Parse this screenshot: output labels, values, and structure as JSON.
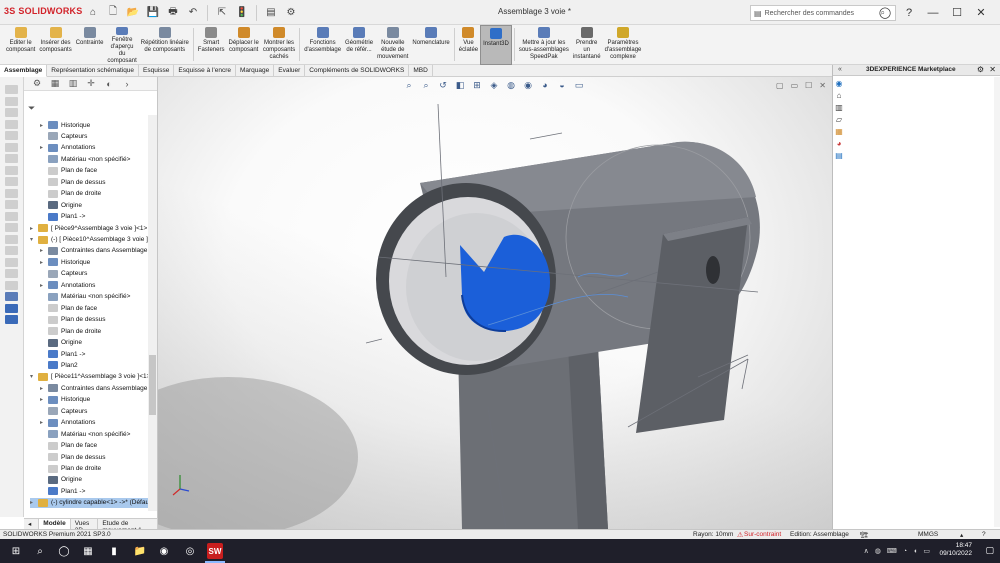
{
  "app": {
    "logo_text": "SOLIDWORKS",
    "logo_prefix": "3S",
    "document_title": "Assemblage 3 voie *"
  },
  "quick_access": [
    {
      "icon": "home-icon",
      "glyph": "⌂"
    },
    {
      "icon": "new-file-icon",
      "glyph": "🗋"
    },
    {
      "icon": "open-file-icon",
      "glyph": "📂"
    },
    {
      "icon": "save-icon",
      "glyph": "💾"
    },
    {
      "icon": "print-icon",
      "glyph": "🖶"
    },
    {
      "icon": "undo-icon",
      "glyph": "↶"
    },
    {
      "icon": "select-icon",
      "glyph": "⇱"
    },
    {
      "icon": "rebuild-icon",
      "glyph": "🚦"
    },
    {
      "icon": "file-properties-icon",
      "glyph": "▤"
    },
    {
      "icon": "options-icon",
      "glyph": "⚙"
    }
  ],
  "search": {
    "placeholder": "Rechercher des commandes",
    "value": ""
  },
  "ribbon": [
    {
      "id": "edit-component",
      "label": "Editer le\ncomposant",
      "color": "#e3b34a"
    },
    {
      "id": "insert-components",
      "label": "Insérer des\ncomposants",
      "color": "#e3b34a"
    },
    {
      "id": "constraint",
      "label": "Contrainte",
      "color": "#7a8aa0"
    },
    {
      "id": "preview-window",
      "label": "Fenêtre\nd'aperçu\ndu\ncomposant",
      "color": "#5a7cb8"
    },
    {
      "id": "linear-pattern",
      "label": "Répétition linéaire\nde composants",
      "color": "#7a8aa0"
    },
    {
      "id": "smart-fasteners",
      "label": "Smart\nFasteners",
      "color": "#8a8a8a"
    },
    {
      "id": "move-component",
      "label": "Déplacer le\ncomposant",
      "color": "#d08a2a"
    },
    {
      "id": "show-hidden",
      "label": "Montrer les\ncomposants\ncachés",
      "color": "#d08a2a"
    },
    {
      "id": "assembly-features",
      "label": "Fonctions\nd'assemblage",
      "color": "#5a7cb8"
    },
    {
      "id": "reference-geometry",
      "label": "Géométrie\nde référ...",
      "color": "#5a7cb8"
    },
    {
      "id": "new-motion-study",
      "label": "Nouvelle\nétude de\nmouvement",
      "color": "#7a8aa0"
    },
    {
      "id": "bom",
      "label": "Nomenclature",
      "color": "#5a7cb8"
    },
    {
      "id": "exploded-view",
      "label": "Vue\néclatée",
      "color": "#d08a2a"
    },
    {
      "id": "instant3d",
      "label": "Instant3D",
      "color": "#2f6ec8",
      "active": true
    },
    {
      "id": "update-speedpak",
      "label": "Mettre à jour les\nsous-assemblages\nSpeedPak",
      "color": "#5a7cb8"
    },
    {
      "id": "take-snapshot",
      "label": "Prendre\nun\ninstantané",
      "color": "#6a6a6a"
    },
    {
      "id": "large-assembly",
      "label": "Paramètres\nd'assemblage\ncomplexe",
      "color": "#d0a82a"
    }
  ],
  "command_tabs": [
    "Assemblage",
    "Représentation schématique",
    "Esquisse",
    "Esquisse à l'encre",
    "Marquage",
    "Evaluer",
    "Compléments de SOLIDWORKS",
    "MBD"
  ],
  "active_command_tab": "Assemblage",
  "tree": [
    {
      "label": "Historique",
      "level": 2,
      "twisty": "▸",
      "color": "#6c8ebf"
    },
    {
      "label": "Capteurs",
      "level": 2,
      "twisty": "",
      "color": "#9aa7b8"
    },
    {
      "label": "Annotations",
      "level": 2,
      "twisty": "▸",
      "color": "#6c8ebf"
    },
    {
      "label": "Matériau <non spécifié>",
      "level": 2,
      "twisty": "",
      "color": "#8aa1bf"
    },
    {
      "label": "Plan de face",
      "level": 2,
      "twisty": "",
      "color": "#cccccc"
    },
    {
      "label": "Plan de dessus",
      "level": 2,
      "twisty": "",
      "color": "#cccccc"
    },
    {
      "label": "Plan de droite",
      "level": 2,
      "twisty": "",
      "color": "#cccccc"
    },
    {
      "label": "Origine",
      "level": 2,
      "twisty": "",
      "color": "#5a6a80"
    },
    {
      "label": "Plan1 ->",
      "level": 2,
      "twisty": "",
      "color": "#4a7ac8"
    },
    {
      "label": "[ Pièce9^Assemblage 3 voie ]<1> (",
      "level": 1,
      "twisty": "▸",
      "color": "#e0b040"
    },
    {
      "label": "(-) [ Pièce10^Assemblage 3 voie ]<",
      "level": 1,
      "twisty": "▾",
      "color": "#e0b040"
    },
    {
      "label": "Contraintes dans Assemblage 3",
      "level": 2,
      "twisty": "▸",
      "color": "#7a8aa0"
    },
    {
      "label": "Historique",
      "level": 2,
      "twisty": "▸",
      "color": "#6c8ebf"
    },
    {
      "label": "Capteurs",
      "level": 2,
      "twisty": "",
      "color": "#9aa7b8"
    },
    {
      "label": "Annotations",
      "level": 2,
      "twisty": "▸",
      "color": "#6c8ebf"
    },
    {
      "label": "Matériau <non spécifié>",
      "level": 2,
      "twisty": "",
      "color": "#8aa1bf"
    },
    {
      "label": "Plan de face",
      "level": 2,
      "twisty": "",
      "color": "#cccccc"
    },
    {
      "label": "Plan de dessus",
      "level": 2,
      "twisty": "",
      "color": "#cccccc"
    },
    {
      "label": "Plan de droite",
      "level": 2,
      "twisty": "",
      "color": "#cccccc"
    },
    {
      "label": "Origine",
      "level": 2,
      "twisty": "",
      "color": "#5a6a80"
    },
    {
      "label": "Plan1 ->",
      "level": 2,
      "twisty": "",
      "color": "#4a7ac8"
    },
    {
      "label": "Plan2",
      "level": 2,
      "twisty": "",
      "color": "#4a7ac8"
    },
    {
      "label": "[ Pièce11^Assemblage 3 voie ]<1>",
      "level": 1,
      "twisty": "▾",
      "color": "#e0b040"
    },
    {
      "label": "Contraintes dans Assemblage 3",
      "level": 2,
      "twisty": "▸",
      "color": "#7a8aa0"
    },
    {
      "label": "Historique",
      "level": 2,
      "twisty": "▸",
      "color": "#6c8ebf"
    },
    {
      "label": "Capteurs",
      "level": 2,
      "twisty": "",
      "color": "#9aa7b8"
    },
    {
      "label": "Annotations",
      "level": 2,
      "twisty": "▸",
      "color": "#6c8ebf"
    },
    {
      "label": "Matériau <non spécifié>",
      "level": 2,
      "twisty": "",
      "color": "#8aa1bf"
    },
    {
      "label": "Plan de face",
      "level": 2,
      "twisty": "",
      "color": "#cccccc"
    },
    {
      "label": "Plan de dessus",
      "level": 2,
      "twisty": "",
      "color": "#cccccc"
    },
    {
      "label": "Plan de droite",
      "level": 2,
      "twisty": "",
      "color": "#cccccc"
    },
    {
      "label": "Origine",
      "level": 2,
      "twisty": "",
      "color": "#5a6a80"
    },
    {
      "label": "Plan1 ->",
      "level": 2,
      "twisty": "",
      "color": "#4a7ac8"
    },
    {
      "label": "(-) cylindre capable<1> ->* (Défaut",
      "level": 1,
      "twisty": "▸",
      "color": "#e0b040",
      "selected": true
    }
  ],
  "fm_tabs": [
    "Modèle",
    "Vues 3D",
    "Etude de mouvement 1"
  ],
  "active_fm_tab": "Modèle",
  "task_pane": {
    "title": "3DEXPERIENCE Marketplace",
    "icons": [
      "globe-icon",
      "home-icon",
      "parts-library-icon",
      "folder-icon",
      "view-palette-icon",
      "appearances-icon",
      "custom-properties-icon"
    ]
  },
  "status": {
    "product": "SOLIDWORKS Premium 2021 SP3.0",
    "radius": "Rayon: 10mm",
    "constraint": "Sur-contraint",
    "mode": "Edition: Assemblage",
    "units": "MMGS"
  },
  "taskbar": {
    "time": "18:47",
    "date": "09/10/2022"
  },
  "colors": {
    "accent_red": "#d2232a",
    "part_gray": "#6b6e74",
    "selected_blue": "#1b5fd9"
  }
}
